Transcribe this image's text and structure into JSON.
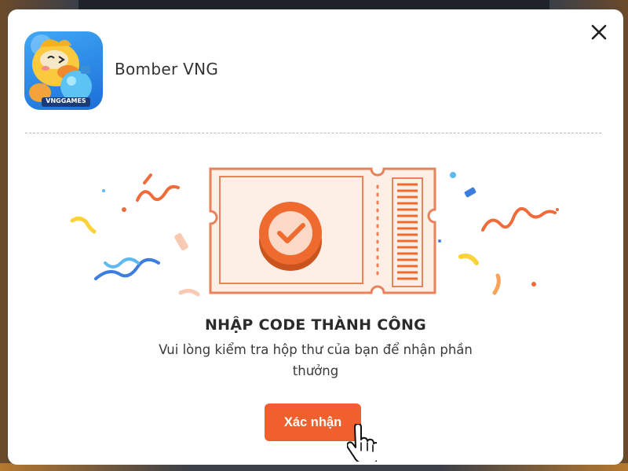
{
  "app": {
    "name": "Bomber VNG",
    "icon_brand_text": "VNGGAMES"
  },
  "dialog": {
    "close_icon": "close-icon",
    "title": "NHẬP CODE THÀNH CÔNG",
    "message": "Vui lòng kiểm tra hộp thư của bạn để nhận phần thưởng",
    "confirm_label": "Xác nhận"
  },
  "colors": {
    "accent": "#f0602e",
    "ticket_bg": "#fdeee6",
    "ticket_stroke": "#e8825a",
    "check_orange": "#ee6a2f"
  }
}
